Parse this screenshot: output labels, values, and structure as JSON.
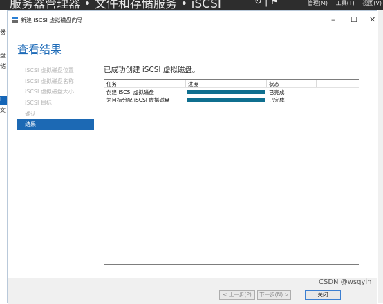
{
  "server_manager": {
    "breadcrumb": "服务器管理器 • 文件和存储服务 • iSCSI",
    "menus": [
      "管理(M)",
      "工具(T)",
      "视图(V)"
    ],
    "left_fragments": [
      "器",
      "盘",
      "储",
      "I",
      "文"
    ]
  },
  "wizard": {
    "window_title": "新建 iSCSI 虚拟磁盘向导",
    "controls": [
      "–",
      "☐",
      "✕"
    ],
    "heading": "查看结果",
    "nav": [
      "iSCSI 虚拟磁盘位置",
      "iSCSI 虚拟磁盘名称",
      "iSCSI 虚拟磁盘大小",
      "iSCSI 目标",
      "确认",
      "结果"
    ],
    "active_step": 5,
    "success_message": "已成功创建 iSCSI 虚拟磁盘。",
    "table": {
      "headers": [
        "任务",
        "进度",
        "状态"
      ],
      "rows": [
        {
          "task": "创建 iSCSI 虚拟磁盘",
          "progress": 100,
          "status": "已完成"
        },
        {
          "task": "为目标分配 iSCSI 虚拟磁盘",
          "progress": 100,
          "status": "已完成"
        }
      ]
    },
    "buttons": {
      "prev": "< 上一步(P)",
      "next": "下一步(N) >",
      "close": "关闭"
    },
    "watermark": "CSDN @wsqyin"
  }
}
